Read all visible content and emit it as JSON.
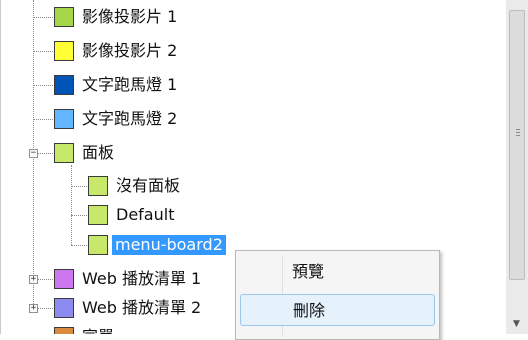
{
  "tree": {
    "items": [
      {
        "label": "影像投影片 1",
        "color": "#a6d64a"
      },
      {
        "label": "影像投影片 2",
        "color": "#ffff33"
      },
      {
        "label": "文字跑馬燈 1",
        "color": "#0054b8"
      },
      {
        "label": "文字跑馬燈 2",
        "color": "#62b5ff"
      },
      {
        "label": "面板",
        "color": "#c8e86a",
        "expander": "−"
      },
      {
        "label": "沒有面板",
        "color": "#c8e86a"
      },
      {
        "label": "Default",
        "color": "#c8e86a"
      },
      {
        "label": "menu-board2",
        "color": "#c8e86a"
      },
      {
        "label": "Web 播放清單 1",
        "color": "#cc77ee",
        "expander": "+"
      },
      {
        "label": "Web 播放清單 2",
        "color": "#8c8cf0",
        "expander": "+"
      },
      {
        "label": "宣單",
        "color": "#d98a3c"
      }
    ]
  },
  "context_menu": {
    "items": [
      {
        "label": "預覽"
      },
      {
        "label": "刪除"
      }
    ]
  }
}
